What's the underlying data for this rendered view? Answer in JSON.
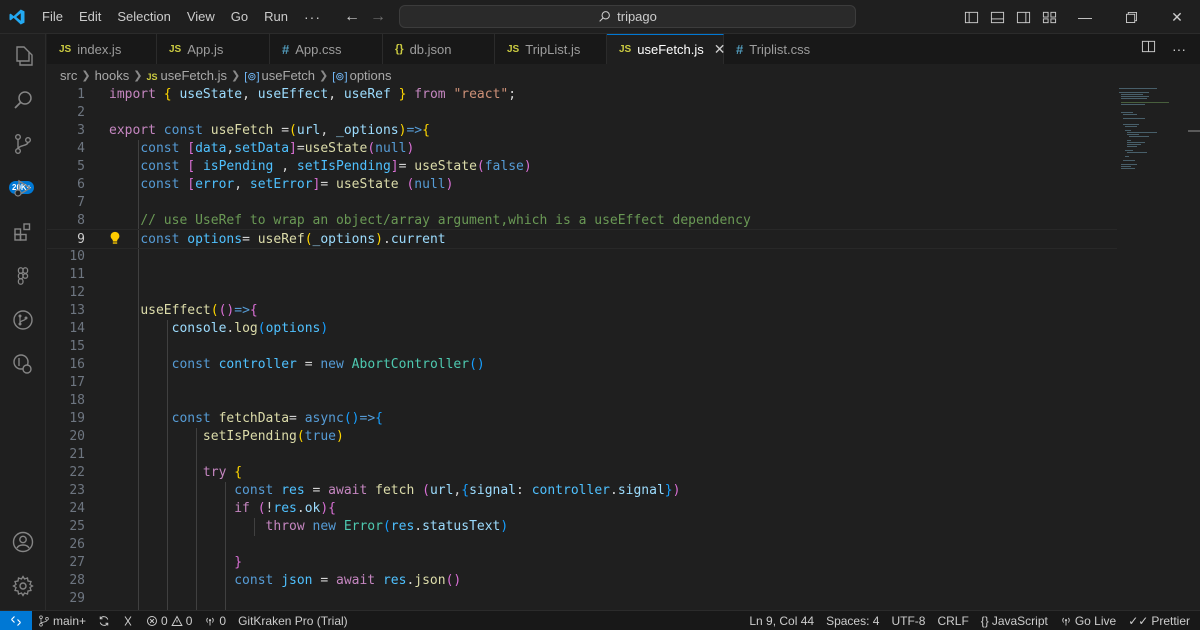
{
  "titlebar": {
    "menu": [
      "File",
      "Edit",
      "Selection",
      "View",
      "Go",
      "Run",
      "···"
    ],
    "search_text": "tripago"
  },
  "activity_bar": {
    "items": [
      "explorer-icon",
      "search-icon",
      "source-control-icon",
      "run-debug-icon",
      "extensions-icon",
      "figma-icon",
      "git-graph-icon",
      "remote-explorer-icon"
    ],
    "source_control_badge": "20K+",
    "bottom_items": [
      "account-icon",
      "settings-gear-icon"
    ]
  },
  "tabs": [
    {
      "icon": "JS",
      "label": "index.js"
    },
    {
      "icon": "JS",
      "label": "App.js"
    },
    {
      "icon": "#",
      "label": "App.css"
    },
    {
      "icon": "{}",
      "label": "db.json"
    },
    {
      "icon": "JS",
      "label": "TripList.js"
    },
    {
      "icon": "JS",
      "label": "useFetch.js",
      "active": true
    },
    {
      "icon": "#",
      "label": "Triplist.css"
    }
  ],
  "breadcrumb": {
    "folder1": "src",
    "folder2": "hooks",
    "file_icon": "JS",
    "file": "useFetch.js",
    "symbol1": "useFetch",
    "symbol2": "options"
  },
  "editor": {
    "current_line": 9,
    "line_numbers": [
      "1",
      "2",
      "3",
      "4",
      "5",
      "6",
      "7",
      "8",
      "9",
      "10",
      "11",
      "12",
      "13",
      "14",
      "15",
      "16",
      "17",
      "18",
      "19",
      "20",
      "21",
      "22",
      "23",
      "24",
      "25",
      "26",
      "27",
      "28",
      "29"
    ]
  },
  "statusbar": {
    "branch": "main+",
    "errors": "0",
    "warnings": "0",
    "ports": "0",
    "gitkraken": "GitKraken Pro (Trial)",
    "position": "Ln 9, Col 44",
    "spaces": "Spaces: 4",
    "encoding": "UTF-8",
    "eol": "CRLF",
    "language": "JavaScript",
    "go_live": "Go Live",
    "prettier": "Prettier"
  },
  "colors": {
    "accent": "#0078d4",
    "editor_bg": "#1f1f1f",
    "keyword": "#569cd6",
    "variable": "#9cdcfe",
    "function": "#dcdcaa",
    "string": "#ce9178",
    "comment": "#6a9955"
  }
}
